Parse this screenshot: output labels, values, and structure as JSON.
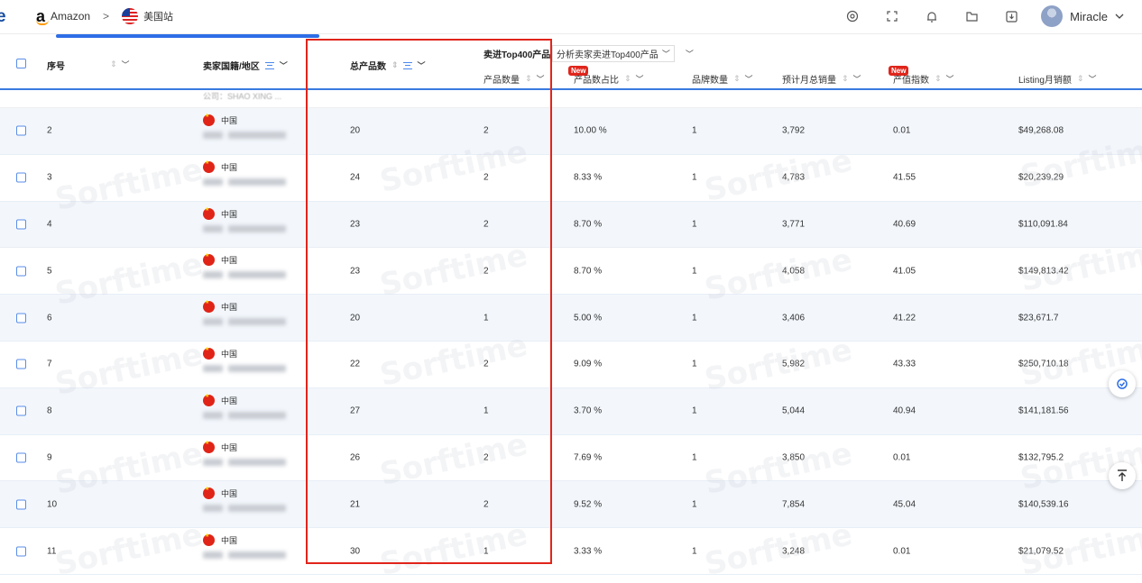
{
  "topbar": {
    "logo_letter": "e",
    "marketplace": "Amazon",
    "separator": ">",
    "site": "美国站",
    "user_name": "Miracle",
    "icons": [
      "settings-icon",
      "fullscreen-icon",
      "bell-icon",
      "folder-icon",
      "download-icon",
      "chevron-down-icon"
    ]
  },
  "header": {
    "col_index": "序号",
    "col_country": "卖家国籍/地区",
    "col_total_products": "总产品数",
    "group_label": "卖进Top400产品",
    "analysis_select": "分析卖家卖进Top400产品",
    "col_product_count": "产品数量",
    "col_product_ratio": "产品数占比",
    "col_brand_count": "品牌数量",
    "col_est_monthly_sales": "预计月总销量",
    "col_value_index": "产值指数",
    "col_listing_sales": "Listing月销额",
    "new_badge": "New"
  },
  "partial_row_text": "公司：SHAO XING ...",
  "country_label": "中国",
  "rows": [
    {
      "idx": "2",
      "total": "20",
      "count": "2",
      "ratio": "10.00 %",
      "brands": "1",
      "sales": "3,792",
      "index": "0.01",
      "revenue": "$49,268.08"
    },
    {
      "idx": "3",
      "total": "24",
      "count": "2",
      "ratio": "8.33 %",
      "brands": "1",
      "sales": "4,783",
      "index": "41.55",
      "revenue": "$20,239.29"
    },
    {
      "idx": "4",
      "total": "23",
      "count": "2",
      "ratio": "8.70 %",
      "brands": "1",
      "sales": "3,771",
      "index": "40.69",
      "revenue": "$110,091.84"
    },
    {
      "idx": "5",
      "total": "23",
      "count": "2",
      "ratio": "8.70 %",
      "brands": "1",
      "sales": "4,058",
      "index": "41.05",
      "revenue": "$149,813.42"
    },
    {
      "idx": "6",
      "total": "20",
      "count": "1",
      "ratio": "5.00 %",
      "brands": "1",
      "sales": "3,406",
      "index": "41.22",
      "revenue": "$23,671.7"
    },
    {
      "idx": "7",
      "total": "22",
      "count": "2",
      "ratio": "9.09 %",
      "brands": "1",
      "sales": "5,982",
      "index": "43.33",
      "revenue": "$250,710.18"
    },
    {
      "idx": "8",
      "total": "27",
      "count": "1",
      "ratio": "3.70 %",
      "brands": "1",
      "sales": "5,044",
      "index": "40.94",
      "revenue": "$141,181.56"
    },
    {
      "idx": "9",
      "total": "26",
      "count": "2",
      "ratio": "7.69 %",
      "brands": "1",
      "sales": "3,850",
      "index": "0.01",
      "revenue": "$132,795.2"
    },
    {
      "idx": "10",
      "total": "21",
      "count": "2",
      "ratio": "9.52 %",
      "brands": "1",
      "sales": "7,854",
      "index": "45.04",
      "revenue": "$140,539.16"
    },
    {
      "idx": "11",
      "total": "30",
      "count": "1",
      "ratio": "3.33 %",
      "brands": "1",
      "sales": "3,248",
      "index": "0.01",
      "revenue": "$21,079.52"
    }
  ],
  "watermark": "Sorftime",
  "colors": {
    "accent": "#2e6ee6",
    "highlight_box": "#e0251b",
    "badge": "#e0251b"
  }
}
